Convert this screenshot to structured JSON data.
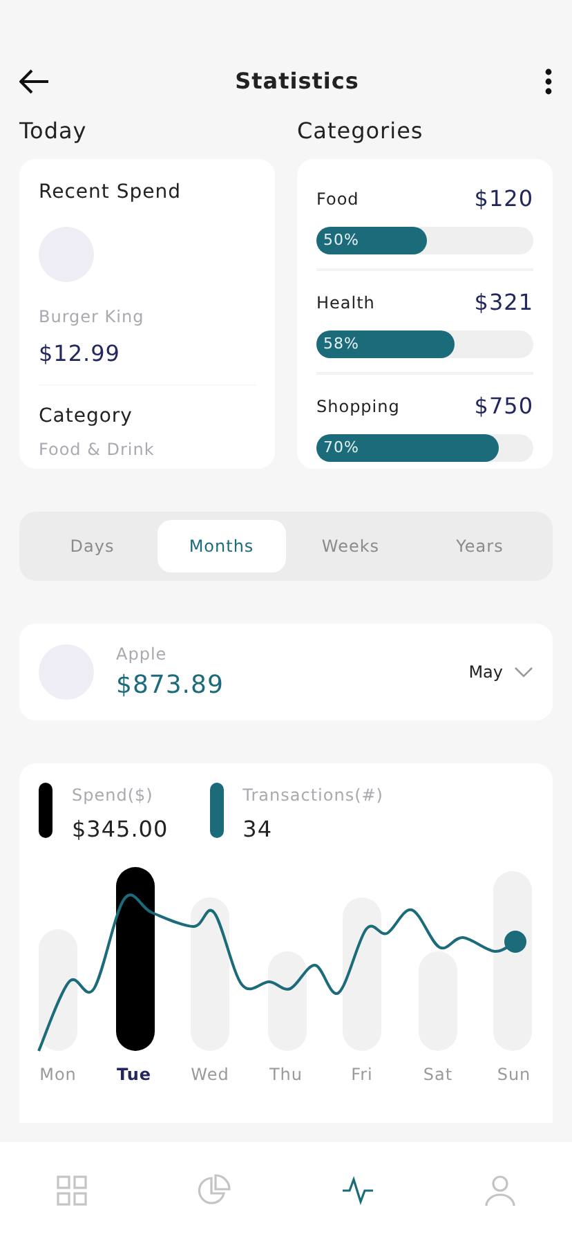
{
  "header": {
    "title": "Statistics"
  },
  "today": {
    "heading": "Today",
    "card": {
      "title": "Recent Spend",
      "merchant": "Burger King",
      "amount": "$12.99",
      "category_label": "Category",
      "category": "Food & Drink"
    }
  },
  "categories": {
    "heading": "Categories",
    "items": [
      {
        "name": "Food",
        "amount": "$120",
        "percent": "50%",
        "level": 0.51
      },
      {
        "name": "Health",
        "amount": "$321",
        "percent": "58%",
        "level": 0.64
      },
      {
        "name": "Shopping",
        "amount": "$750",
        "percent": "70%",
        "level": 0.84
      }
    ]
  },
  "periods": [
    {
      "label": "Days",
      "selected": false
    },
    {
      "label": "Months",
      "selected": true
    },
    {
      "label": "Weeks",
      "selected": false
    },
    {
      "label": "Years",
      "selected": false
    }
  ],
  "account": {
    "name": "Apple",
    "amount": "$873.89",
    "month": "May"
  },
  "chart": {
    "legend": [
      {
        "label": "Spend($)",
        "value": "$345.00",
        "color": "#000000"
      },
      {
        "label": "Transactions(#)",
        "value": "34",
        "color": "#1b6b7a"
      }
    ],
    "days": [
      {
        "label": "Mon",
        "selected": false
      },
      {
        "label": "Tue",
        "selected": true
      },
      {
        "label": "Wed",
        "selected": false
      },
      {
        "label": "Thu",
        "selected": false
      },
      {
        "label": "Fri",
        "selected": false
      },
      {
        "label": "Sat",
        "selected": false
      },
      {
        "label": "Sun",
        "selected": false
      }
    ]
  },
  "nav": [
    {
      "kind": "grid",
      "selected": false
    },
    {
      "kind": "pie",
      "selected": false
    },
    {
      "kind": "pulse",
      "selected": true
    },
    {
      "kind": "user",
      "selected": false
    }
  ]
}
